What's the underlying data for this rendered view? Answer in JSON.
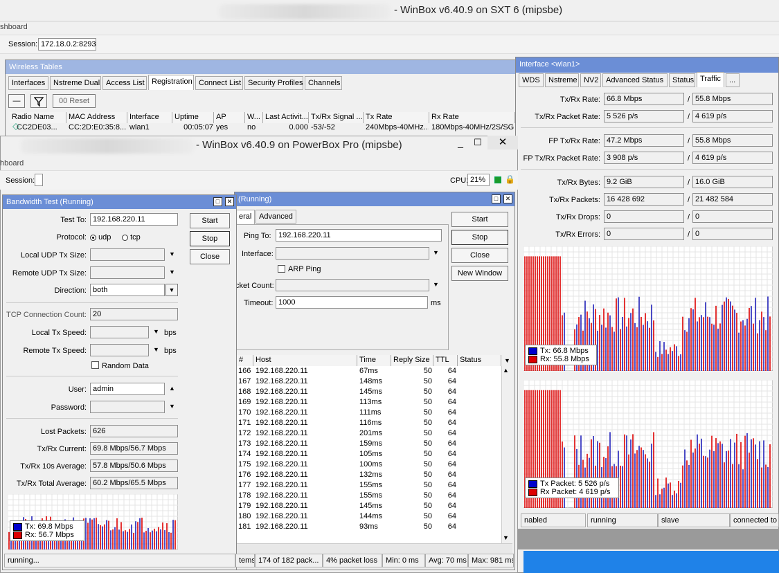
{
  "win1": {
    "title": "- WinBox v6.40.9 on SXT 6 (mipsbe)",
    "menu": "shboard",
    "session_label": "Session:",
    "session_value": "172.18.0.2:8293"
  },
  "wireless": {
    "title": "Wireless Tables",
    "tabs": [
      "Interfaces",
      "Nstreme Dual",
      "Access List",
      "Registration",
      "Connect List",
      "Security Profiles",
      "Channels"
    ],
    "reset_label": "Reset",
    "columns": [
      "Radio Name",
      "MAC Address",
      "Interface",
      "Uptime",
      "AP",
      "W...",
      "Last Activit...",
      "Tx/Rx Signal ...",
      "Tx Rate",
      "Rx Rate"
    ],
    "row": [
      "CC2DE03...",
      "CC:2D:E0:35:8...",
      "wlan1",
      "00:05:07",
      "yes",
      "no",
      "0.000",
      "-53/-52",
      "240Mbps-40MHz...",
      "180Mbps-40MHz/2S/SG"
    ]
  },
  "iface": {
    "title": "Interface <wlan1>",
    "tabs": [
      "WDS",
      "Nstreme",
      "NV2",
      "Advanced Status",
      "Status",
      "Traffic",
      "..."
    ],
    "rows": [
      {
        "label": "Tx/Rx Rate:",
        "a": "66.8 Mbps",
        "b": "55.8 Mbps"
      },
      {
        "label": "Tx/Rx Packet Rate:",
        "a": "5 526 p/s",
        "b": "4 619 p/s"
      },
      {
        "label": "FP Tx/Rx Rate:",
        "a": "47.2 Mbps",
        "b": "55.8 Mbps"
      },
      {
        "label": "FP Tx/Rx Packet Rate:",
        "a": "3 908 p/s",
        "b": "4 619 p/s"
      },
      {
        "label": "Tx/Rx Bytes:",
        "a": "9.2 GiB",
        "b": "16.0 GiB"
      },
      {
        "label": "Tx/Rx Packets:",
        "a": "16 428 692",
        "b": "21 482 584"
      },
      {
        "label": "Tx/Rx Drops:",
        "a": "0",
        "b": "0"
      },
      {
        "label": "Tx/Rx Errors:",
        "a": "0",
        "b": "0"
      }
    ],
    "legend1": {
      "tx": "Tx:  66.8 Mbps",
      "rx": "Rx:  55.8 Mbps"
    },
    "legend2": {
      "tx": "Tx Packet:  5 526 p/s",
      "rx": "Rx Packet:  4 619 p/s"
    },
    "status": [
      "nabled",
      "running",
      "slave",
      "connected to c"
    ]
  },
  "win2": {
    "title": "- WinBox v6.40.9 on PowerBox Pro (mipsbe)",
    "menu": "hboard",
    "session_label": "Session:",
    "cpu_label": "CPU:",
    "cpu_value": "21%"
  },
  "btest": {
    "title": "Bandwidth Test (Running)",
    "test_to_label": "Test To:",
    "test_to": "192.168.220.11",
    "protocol_label": "Protocol:",
    "udp": "udp",
    "tcp": "tcp",
    "local_udp_label": "Local UDP Tx Size:",
    "remote_udp_label": "Remote UDP Tx Size:",
    "direction_label": "Direction:",
    "direction": "both",
    "tcp_count_label": "TCP Connection Count:",
    "tcp_count": "20",
    "local_speed_label": "Local Tx Speed:",
    "remote_speed_label": "Remote Tx Speed:",
    "bps": "bps",
    "random_label": "Random Data",
    "user_label": "User:",
    "user": "admin",
    "password_label": "Password:",
    "lost_label": "Lost Packets:",
    "lost": "626",
    "current_label": "Tx/Rx Current:",
    "current": "69.8 Mbps/56.7 Mbps",
    "avg10_label": "Tx/Rx 10s Average:",
    "avg10": "57.8 Mbps/50.6 Mbps",
    "total_label": "Tx/Rx Total Average:",
    "total": "60.2 Mbps/65.5 Mbps",
    "start": "Start",
    "stop": "Stop",
    "close": "Close",
    "legend": {
      "tx": "Tx:  69.8 Mbps",
      "rx": "Rx:  56.7 Mbps"
    },
    "status": "running..."
  },
  "ping": {
    "title": "(Running)",
    "tabs": [
      "eral",
      "Advanced"
    ],
    "ping_to_label": "Ping To:",
    "ping_to": "192.168.220.11",
    "interface_label": "Interface:",
    "arp_label": "ARP Ping",
    "count_label": "cket Count:",
    "timeout_label": "Timeout:",
    "timeout": "1000",
    "ms": "ms",
    "start": "Start",
    "stop": "Stop",
    "close": "Close",
    "new_window": "New Window",
    "columns": [
      "#",
      "Host",
      "Time",
      "Reply Size",
      "TTL",
      "Status"
    ],
    "rows": [
      [
        "166",
        "192.168.220.11",
        "67ms",
        "50",
        "64"
      ],
      [
        "167",
        "192.168.220.11",
        "148ms",
        "50",
        "64"
      ],
      [
        "168",
        "192.168.220.11",
        "145ms",
        "50",
        "64"
      ],
      [
        "169",
        "192.168.220.11",
        "113ms",
        "50",
        "64"
      ],
      [
        "170",
        "192.168.220.11",
        "111ms",
        "50",
        "64"
      ],
      [
        "171",
        "192.168.220.11",
        "116ms",
        "50",
        "64"
      ],
      [
        "172",
        "192.168.220.11",
        "201ms",
        "50",
        "64"
      ],
      [
        "173",
        "192.168.220.11",
        "159ms",
        "50",
        "64"
      ],
      [
        "174",
        "192.168.220.11",
        "105ms",
        "50",
        "64"
      ],
      [
        "175",
        "192.168.220.11",
        "100ms",
        "50",
        "64"
      ],
      [
        "176",
        "192.168.220.11",
        "132ms",
        "50",
        "64"
      ],
      [
        "177",
        "192.168.220.11",
        "155ms",
        "50",
        "64"
      ],
      [
        "178",
        "192.168.220.11",
        "155ms",
        "50",
        "64"
      ],
      [
        "179",
        "192.168.220.11",
        "145ms",
        "50",
        "64"
      ],
      [
        "180",
        "192.168.220.11",
        "144ms",
        "50",
        "64"
      ],
      [
        "181",
        "192.168.220.11",
        "93ms",
        "50",
        "64"
      ]
    ],
    "status": [
      "tems",
      "174 of 182 pack...",
      "4% packet loss",
      "Min: 0 ms",
      "Avg: 70 ms",
      "Max: 981 ms"
    ]
  },
  "colors": {
    "title_blue": "#6b8ed6",
    "tx": "#0000cc",
    "rx": "#dd0000"
  }
}
